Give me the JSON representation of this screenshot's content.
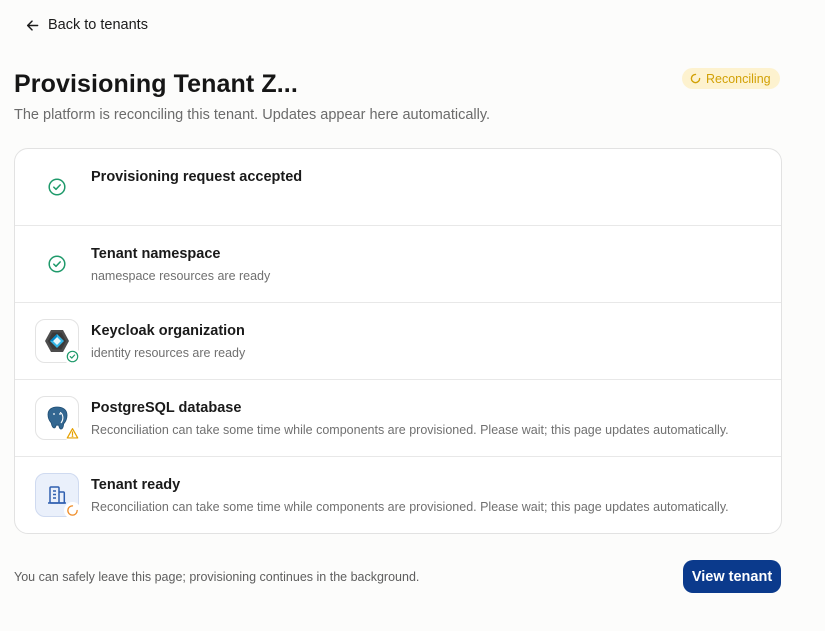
{
  "nav": {
    "back_label": "Back to tenants"
  },
  "header": {
    "title": "Provisioning Tenant Z...",
    "subtitle": "The platform is reconciling this tenant. Updates appear here automatically.",
    "status_label": "Reconciling",
    "status_color": "#d2a106"
  },
  "steps": [
    {
      "title": "Provisioning request accepted",
      "description": "",
      "icon": "check-circle-icon",
      "state": "done"
    },
    {
      "title": "Tenant namespace",
      "description": "namespace resources are ready",
      "icon": "check-circle-icon",
      "state": "done"
    },
    {
      "title": "Keycloak organization",
      "description": "identity resources are ready",
      "icon": "keycloak-logo-icon",
      "state": "done"
    },
    {
      "title": "PostgreSQL database",
      "description": "Reconciliation can take some time while components are provisioned. Please wait; this page updates automatically.",
      "icon": "postgresql-logo-icon",
      "state": "warning"
    },
    {
      "title": "Tenant ready",
      "description": "Reconciliation can take some time while components are provisioned. Please wait; this page updates automatically.",
      "icon": "building-icon",
      "state": "in-progress"
    }
  ],
  "footer": {
    "note": "You can safely leave this page; provisioning continues in the background.",
    "button_label": "View tenant"
  },
  "colors": {
    "success": "#1f9a6b",
    "warning": "#e6a100",
    "progress": "#ef8b25",
    "primary": "#0b3a8c"
  }
}
